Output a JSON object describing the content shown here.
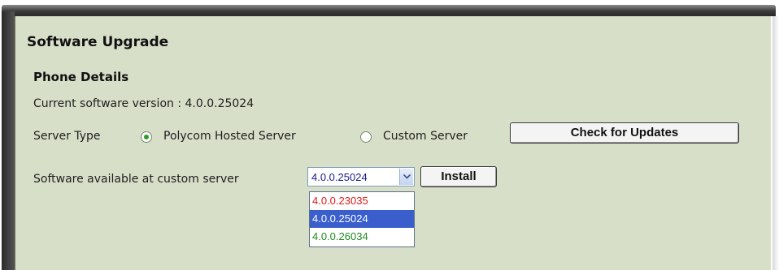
{
  "title": "Software Upgrade",
  "phone_details": {
    "heading": "Phone Details",
    "current_version_label": "Current software version : 4.0.0.25024"
  },
  "server_type": {
    "label": "Server Type",
    "options": [
      {
        "label": "Polycom Hosted Server",
        "checked": true
      },
      {
        "label": "Custom Server",
        "checked": false
      }
    ],
    "check_button": "Check for Updates"
  },
  "custom_software": {
    "label": "Software available at custom server",
    "selected": "4.0.0.25024",
    "install_button": "Install",
    "options": [
      {
        "label": "4.0.0.23035",
        "color": "#e01818"
      },
      {
        "label": "4.0.0.25024",
        "color": "#ffffff",
        "selected": true
      },
      {
        "label": "4.0.0.26034",
        "color": "#1f8a1f"
      }
    ]
  },
  "colors": {
    "panel_bg": "#d8dfc9",
    "selected_item_bg": "#3a5fcd"
  }
}
